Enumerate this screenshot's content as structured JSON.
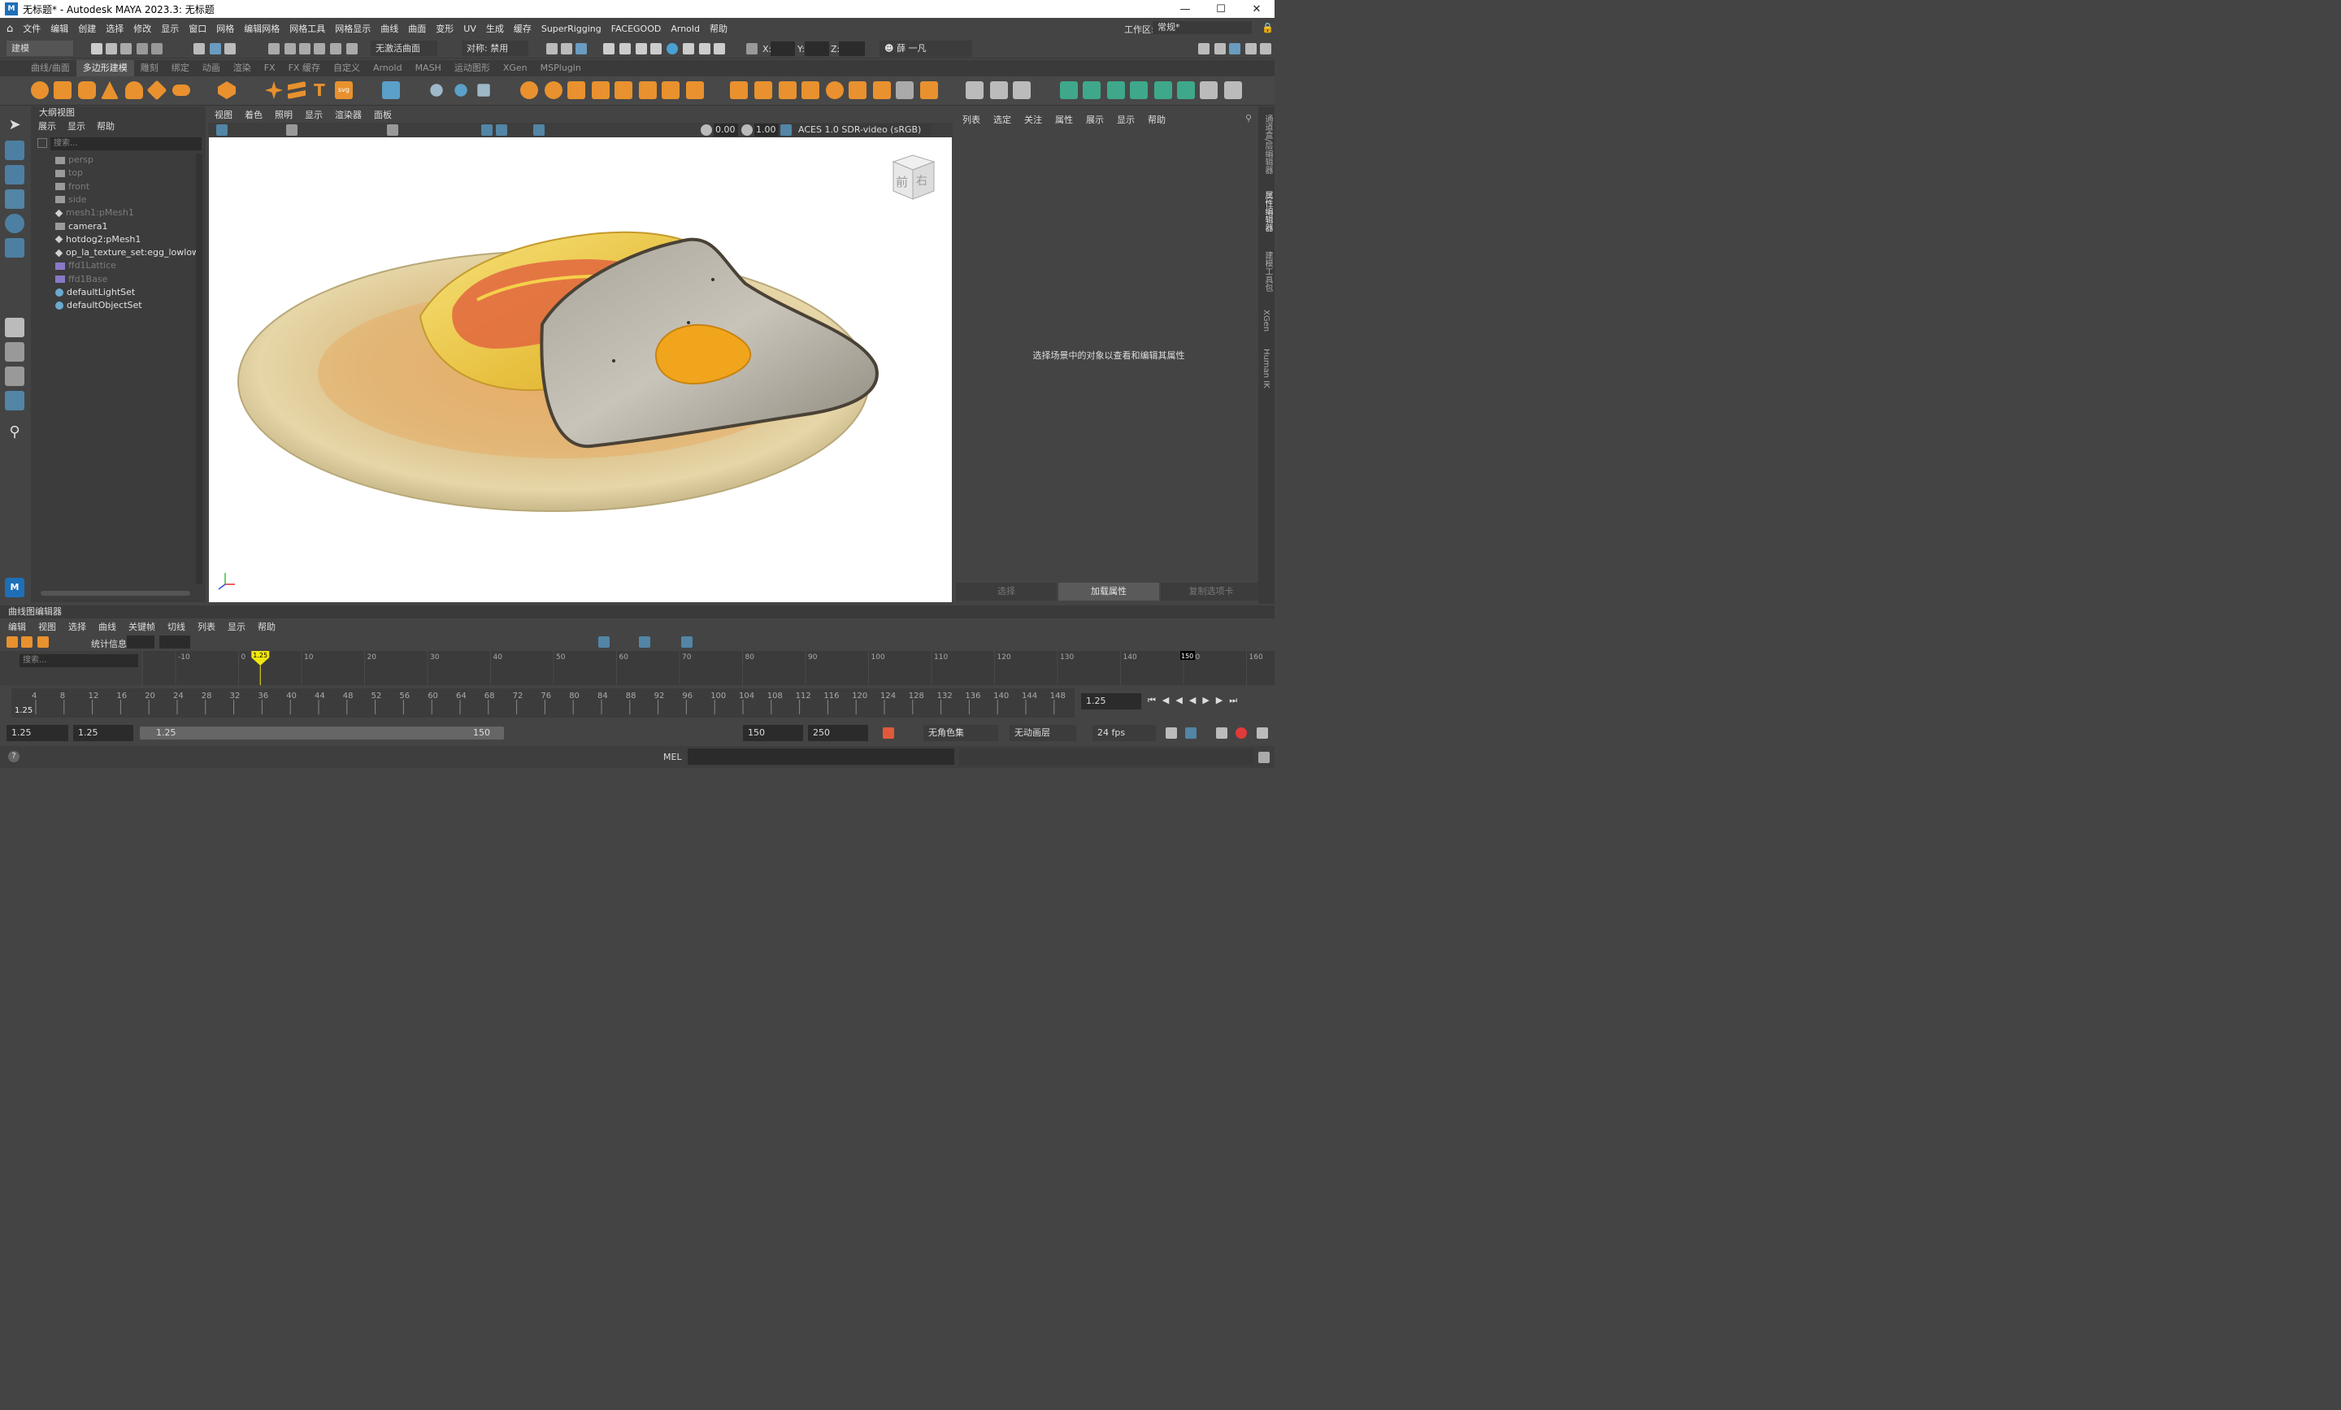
{
  "window": {
    "title": "无标题* - Autodesk MAYA 2023.3: 无标题",
    "app_icon_label": "M"
  },
  "menubar": [
    "文件",
    "编辑",
    "创建",
    "选择",
    "修改",
    "显示",
    "窗口",
    "网格",
    "编辑网格",
    "网格工具",
    "网格显示",
    "曲线",
    "曲面",
    "变形",
    "UV",
    "生成",
    "缓存",
    "SuperRigging",
    "FACEGOOD",
    "Arnold",
    "帮助"
  ],
  "workspace": {
    "label": "工作区:",
    "value": "常规*"
  },
  "status_line": {
    "mode": "建模",
    "live_surface": "无激活曲面",
    "symmetry": "对称: 禁用",
    "x_label": "X:",
    "y_label": "Y:",
    "z_label": "Z:",
    "user": "薛 一凡"
  },
  "shelf_tabs": [
    "曲线/曲面",
    "多边形建模",
    "雕刻",
    "绑定",
    "动画",
    "渲染",
    "FX",
    "FX 缓存",
    "自定义",
    "Arnold",
    "MASH",
    "运动图形",
    "XGen",
    "MSPlugin"
  ],
  "shelf_active_tab": "多边形建模",
  "outliner": {
    "title": "大纲视图",
    "menu": [
      "展示",
      "显示",
      "帮助"
    ],
    "search_placeholder": "搜索...",
    "items": [
      {
        "label": "persp",
        "dim": true,
        "icon": "camera-icon"
      },
      {
        "label": "top",
        "dim": true,
        "icon": "camera-icon"
      },
      {
        "label": "front",
        "dim": true,
        "icon": "camera-icon"
      },
      {
        "label": "side",
        "dim": true,
        "icon": "camera-icon"
      },
      {
        "label": "mesh1:pMesh1",
        "dim": true,
        "icon": "mesh-icon"
      },
      {
        "label": "camera1",
        "dim": false,
        "icon": "camera-icon"
      },
      {
        "label": "hotdog2:pMesh1",
        "dim": false,
        "icon": "mesh-icon"
      },
      {
        "label": "op_la_texture_set:egg_lowlow",
        "dim": false,
        "icon": "mesh-icon"
      },
      {
        "label": "ffd1Lattice",
        "dim": true,
        "icon": "lattice-icon"
      },
      {
        "label": "ffd1Base",
        "dim": true,
        "icon": "lattice-icon"
      },
      {
        "label": "defaultLightSet",
        "dim": false,
        "icon": "set-icon"
      },
      {
        "label": "defaultObjectSet",
        "dim": false,
        "icon": "set-icon"
      }
    ]
  },
  "viewport": {
    "menu": [
      "视图",
      "着色",
      "照明",
      "显示",
      "渲染器",
      "面板"
    ],
    "exposure": "0.00",
    "gamma": "1.00",
    "color_space": "ACES 1.0 SDR-video (sRGB)",
    "viewcube_front": "前",
    "viewcube_right": "右"
  },
  "attribute_editor": {
    "menu": [
      "列表",
      "选定",
      "关注",
      "属性",
      "展示",
      "显示",
      "帮助"
    ],
    "message": "选择场景中的对象以查看和编辑其属性",
    "buttons": [
      "选择",
      "加载属性",
      "复制选项卡"
    ],
    "active_button": "加载属性"
  },
  "side_tabs": [
    "通道盒/层编辑器",
    "属性编辑器",
    "建模工具包",
    "XGen",
    "Human IK"
  ],
  "graph_editor": {
    "title": "曲线图编辑器",
    "menu": [
      "编辑",
      "视图",
      "选择",
      "曲线",
      "关键帧",
      "切线",
      "列表",
      "显示",
      "帮助"
    ],
    "stats_label": "统计信息",
    "search_placeholder": "搜索...",
    "ruler": [
      "-10",
      "0",
      "10",
      "20",
      "30",
      "40",
      "50",
      "60",
      "70",
      "80",
      "90",
      "100",
      "110",
      "120",
      "130",
      "140",
      "150",
      "160"
    ],
    "current_frame_label": "1.25",
    "end_marker": "150"
  },
  "time_slider": {
    "ticks": [
      "4",
      "8",
      "12",
      "16",
      "20",
      "24",
      "28",
      "32",
      "36",
      "40",
      "44",
      "48",
      "52",
      "56",
      "60",
      "64",
      "68",
      "72",
      "76",
      "80",
      "84",
      "88",
      "92",
      "96",
      "100",
      "104",
      "108",
      "112",
      "116",
      "120",
      "124",
      "128",
      "132",
      "136",
      "140",
      "144",
      "148"
    ],
    "current": "1.25",
    "current_field": "1.25"
  },
  "range": {
    "start": "1.25",
    "anim_start": "1.25",
    "slider_start": "1.25",
    "slider_end": "150",
    "anim_end": "150",
    "end": "250",
    "character_set": "无角色集",
    "anim_layer": "无动画层",
    "fps": "24 fps"
  },
  "command_line": {
    "language": "MEL"
  },
  "colors": {
    "panel": "#444444",
    "dark": "#2b2b2b",
    "accent_blue": "#5285a6",
    "key_yellow": "#f2e60f",
    "shelf_orange": "#e8912e",
    "shelf_green": "#3fa88a"
  }
}
